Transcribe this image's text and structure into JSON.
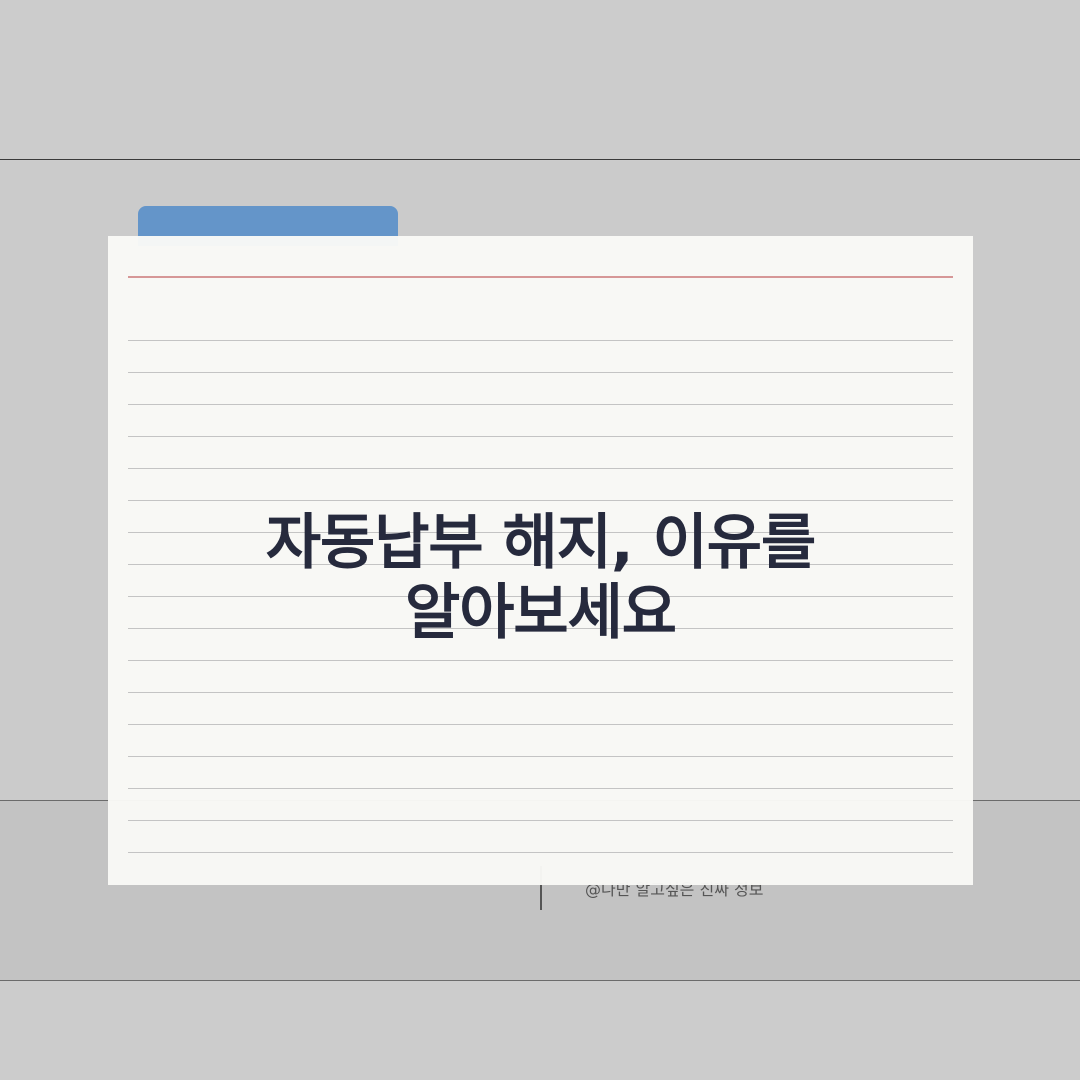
{
  "headline": {
    "line1": "자동납부 해지, 이유를",
    "line2": "알아보세요"
  },
  "footer": {
    "credit": "@나만 알고싶은 진짜 정보"
  },
  "colors": {
    "background": "#cccccc",
    "card": "#f9f9f6",
    "folder_tab": "#6495c9",
    "margin_rule": "#d69797",
    "ruled_line": "#c4c4c4",
    "headline_text": "#262a3d"
  }
}
